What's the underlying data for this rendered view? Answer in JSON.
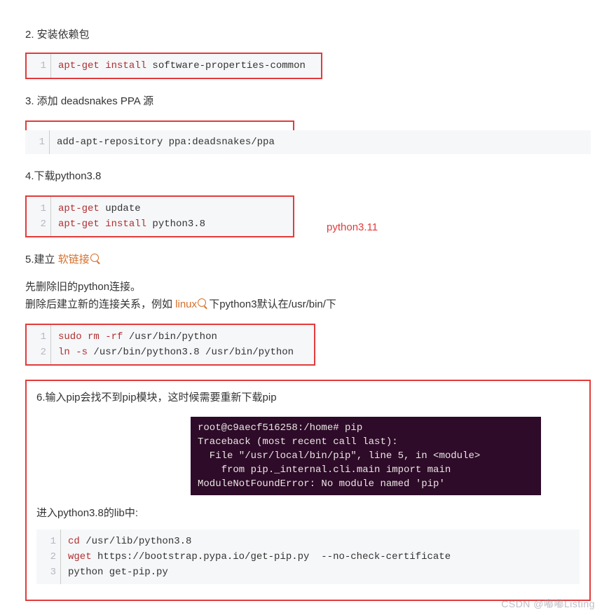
{
  "steps": {
    "s2": {
      "title": "2. 安装依赖包"
    },
    "s3": {
      "title": "3. 添加 deadsnakes PPA 源"
    },
    "s4": {
      "title": "4.下载python3.8",
      "annotation": "python3.11"
    },
    "s5": {
      "prefix": "5.建立 ",
      "link": "软链接",
      "line2": "先删除旧的python连接。",
      "line3a": "删除后建立新的连接关系，例如 ",
      "line3_link": "linux",
      "line3b": " 下python3默认在/usr/bin/下"
    },
    "s6": {
      "title": "6.输入pip会找不到pip模块，这时候需要重新下载pip",
      "subtitle": "进入python3.8的lib中:"
    }
  },
  "code": {
    "c2": {
      "lines": [
        "1"
      ],
      "l1_kw1": "apt-get",
      "l1_kw2": "install",
      "l1_rest": " software-properties-common"
    },
    "c3": {
      "lines": [
        "1"
      ],
      "l1": "add-apt-repository ppa:deadsnakes/ppa"
    },
    "c4": {
      "lines": [
        "1",
        "2"
      ],
      "l1_kw": "apt-get",
      "l1_rest": " update",
      "l2_kw1": "apt-get",
      "l2_kw2": "install",
      "l2_rest": " python3.8"
    },
    "c5": {
      "lines": [
        "1",
        "2"
      ],
      "l1_kw1": "sudo",
      "l1_kw2": "rm",
      "l1_kw3": "-rf",
      "l1_rest": " /usr/bin/python",
      "l2_kw1": "ln",
      "l2_kw2": "-s",
      "l2_rest": " /usr/bin/python3.8 /usr/bin/python"
    },
    "c6": {
      "lines": [
        "1",
        "2",
        "3"
      ],
      "l1_kw": "cd",
      "l1_rest": " /usr/lib/python3.8",
      "l2_kw": "wget",
      "l2_rest": " https://bootstrap.pypa.io/get-pip.py  --no-check-certificate",
      "l3": "python get-pip.py"
    }
  },
  "terminal": {
    "text": "root@c9aecf516258:/home# pip\nTraceback (most recent call last):\n  File \"/usr/local/bin/pip\", line 5, in <module>\n    from pip._internal.cli.main import main\nModuleNotFoundError: No module named 'pip'"
  },
  "watermark": "CSDN @嘟嘟Listing"
}
